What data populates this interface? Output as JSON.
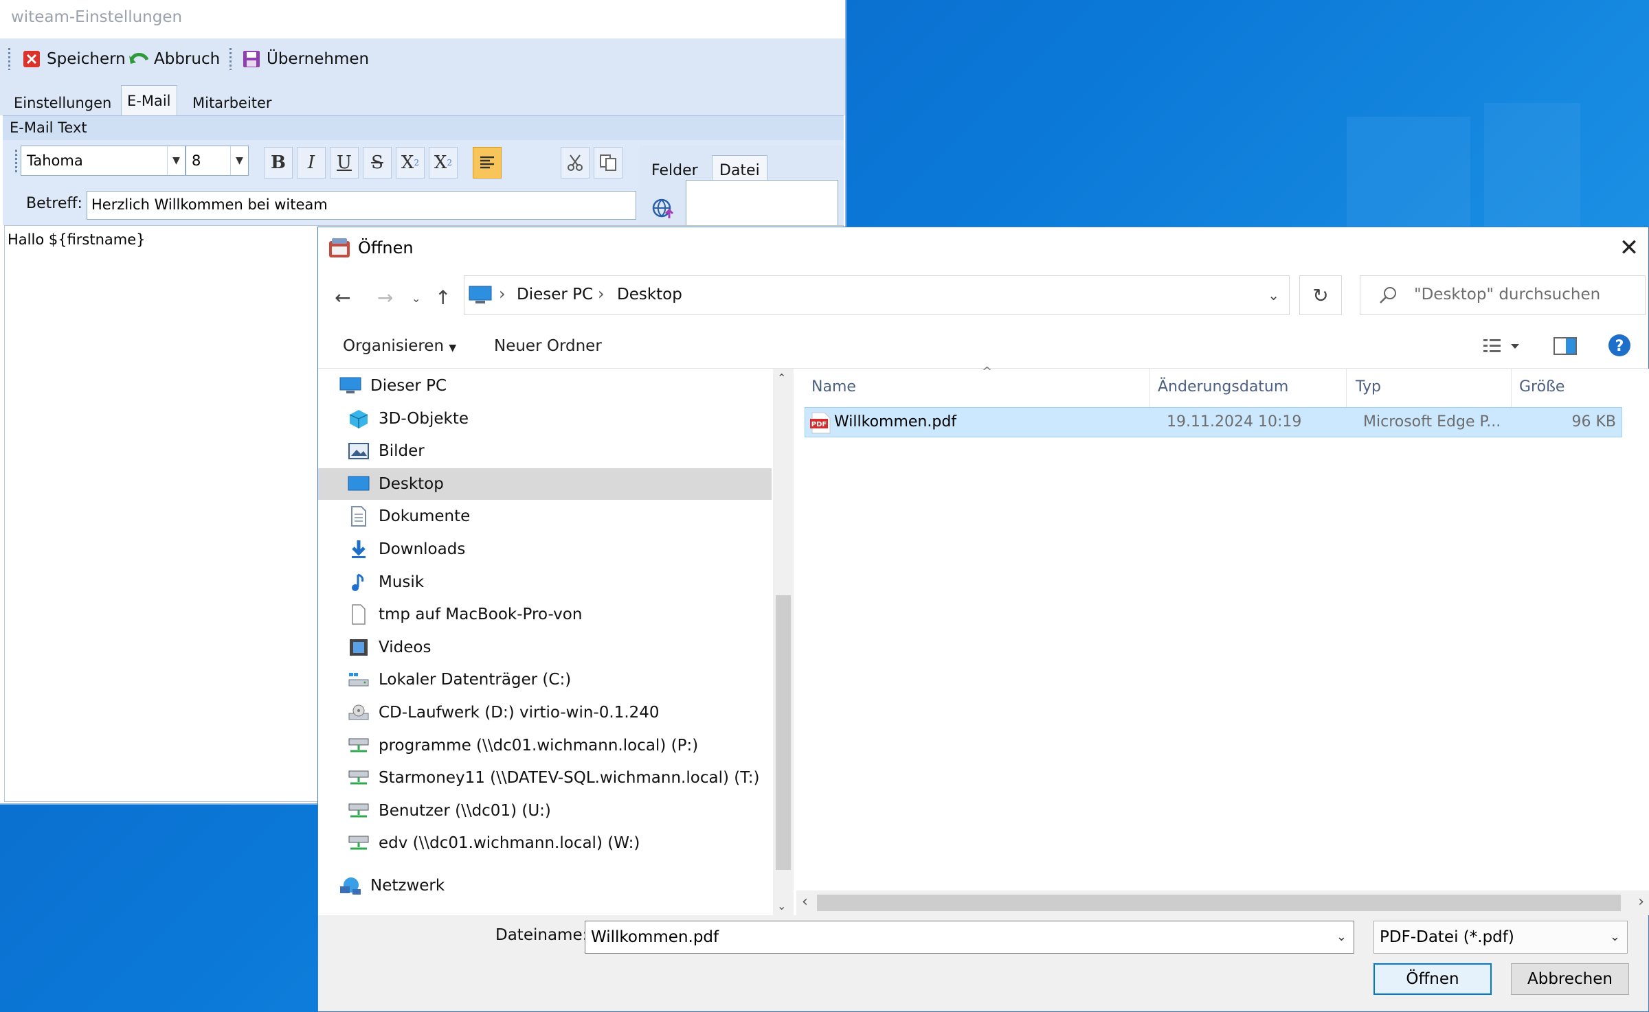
{
  "witeam": {
    "title": "witeam-Einstellungen",
    "toolbar": {
      "save": "Speichern",
      "cancel": "Abbruch",
      "apply": "Übernehmen"
    },
    "tabs": [
      "Einstellungen",
      "E-Mail",
      "Mitarbeiter"
    ],
    "section_title": "E-Mail Text",
    "font": "Tahoma",
    "font_size": "8",
    "format_buttons": [
      "B",
      "I",
      "U",
      "S",
      "X",
      "X"
    ],
    "subject_label": "Betreff:",
    "subject_value": "Herzlich Willkommen bei witeam",
    "side_tabs": [
      "Felder",
      "Datei"
    ],
    "body_text": "Hallo ${firstname}"
  },
  "dialog": {
    "title": "Öffnen",
    "breadcrumb": [
      "Dieser PC",
      "Desktop"
    ],
    "search_placeholder": "\"Desktop\" durchsuchen",
    "commands": {
      "organize": "Organisieren",
      "new_folder": "Neuer Ordner"
    },
    "tree": [
      {
        "label": "Dieser PC",
        "icon": "pc-icon"
      },
      {
        "label": "3D-Objekte",
        "icon": "3d-objects-icon"
      },
      {
        "label": "Bilder",
        "icon": "pictures-icon"
      },
      {
        "label": "Desktop",
        "icon": "desktop-icon",
        "selected": true
      },
      {
        "label": "Dokumente",
        "icon": "documents-icon"
      },
      {
        "label": "Downloads",
        "icon": "downloads-icon"
      },
      {
        "label": "Musik",
        "icon": "music-icon"
      },
      {
        "label": "tmp auf MacBook-Pro-von",
        "icon": "file-icon"
      },
      {
        "label": "Videos",
        "icon": "videos-icon"
      },
      {
        "label": "Lokaler Datenträger (C:)",
        "icon": "local-drive-icon"
      },
      {
        "label": "CD-Laufwerk (D:) virtio-win-0.1.240",
        "icon": "cd-drive-icon"
      },
      {
        "label": "programme (\\\\dc01.wichmann.local) (P:)",
        "icon": "network-drive-icon"
      },
      {
        "label": "Starmoney11 (\\\\DATEV-SQL.wichmann.local) (T:)",
        "icon": "network-drive-icon"
      },
      {
        "label": "Benutzer (\\\\dc01) (U:)",
        "icon": "network-drive-icon"
      },
      {
        "label": "edv (\\\\dc01.wichmann.local) (W:)",
        "icon": "network-drive-icon"
      },
      {
        "label": "Netzwerk",
        "icon": "network-icon"
      }
    ],
    "columns": [
      "Name",
      "Änderungsdatum",
      "Typ",
      "Größe"
    ],
    "files": [
      {
        "name": "Willkommen.pdf",
        "date": "19.11.2024 10:19",
        "type": "Microsoft Edge P...",
        "size": "96 KB"
      }
    ],
    "filename_label": "Dateiname:",
    "filename_value": "Willkommen.pdf",
    "filetype": "PDF-Datei (*.pdf)",
    "open_button": "Öffnen",
    "cancel_button": "Abbrechen"
  },
  "colors": {
    "accent": "#0078d7",
    "selection": "#cce8ff",
    "desktop": "#0b79d8"
  }
}
